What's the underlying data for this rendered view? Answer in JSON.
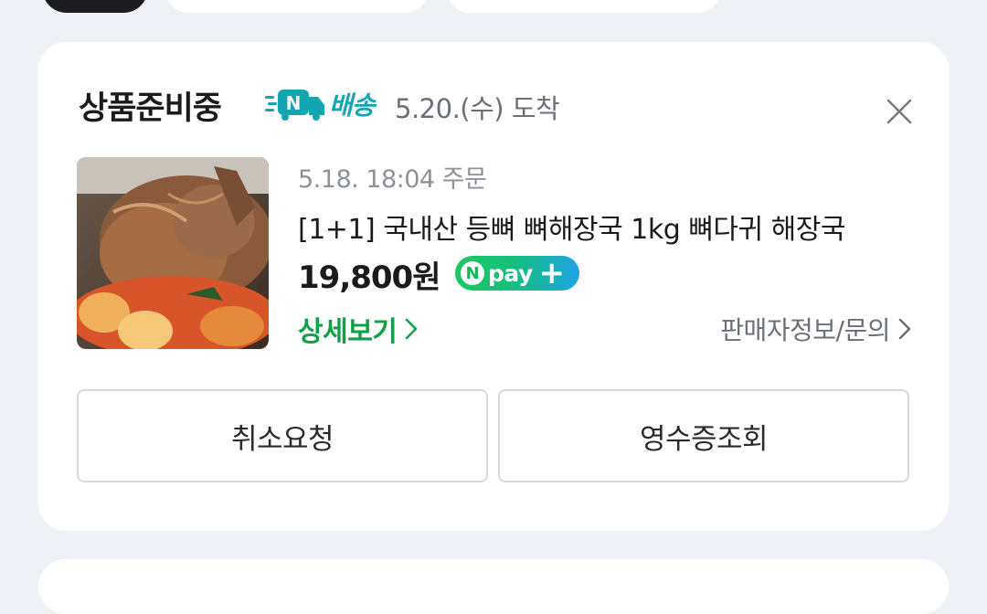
{
  "order_card": {
    "status": "상품준비중",
    "delivery_badge": "배송",
    "arrival": "5.20.(수) 도착",
    "order_date": "5.18. 18:04 주문",
    "product_name": "[1+1] 국내산 등뼈 뼈해장국 1kg 뼈다귀 해장국",
    "price": "19,800원",
    "npay_label": "pay",
    "detail_link": "상세보기",
    "seller_link": "판매자정보/문의",
    "cancel_button": "취소요청",
    "receipt_button": "영수증조회"
  },
  "icons": {
    "delivery": "n-delivery-truck-icon",
    "close": "close-icon",
    "chevron": "chevron-right-icon",
    "npay": "npay-plus-icon"
  },
  "colors": {
    "accent_green": "#10a048",
    "delivery_teal": "#13a6b2",
    "background": "#eef1f5"
  }
}
